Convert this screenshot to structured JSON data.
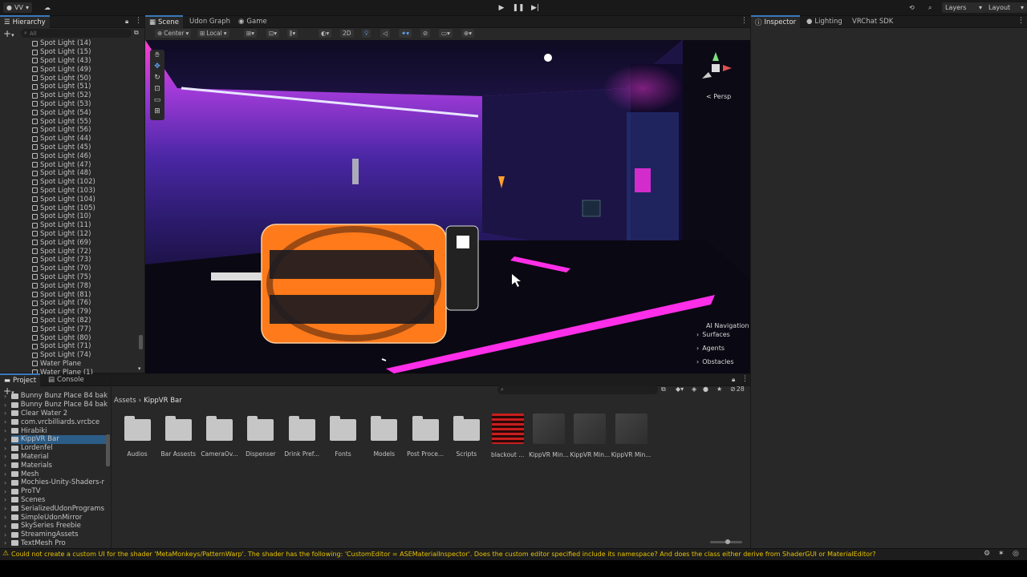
{
  "toolbar": {
    "account": "VV",
    "layers": "Layers",
    "layout": "Layout"
  },
  "hierarchy": {
    "title": "Hierarchy",
    "search_placeholder": "All",
    "items": [
      "Spot Light (14)",
      "Spot Light (15)",
      "Spot Light (43)",
      "Spot Light (49)",
      "Spot Light (50)",
      "Spot Light (51)",
      "Spot Light (52)",
      "Spot Light (53)",
      "Spot Light (54)",
      "Spot Light (55)",
      "Spot Light (56)",
      "Spot Light (44)",
      "Spot Light (45)",
      "Spot Light (46)",
      "Spot Light (47)",
      "Spot Light (48)",
      "Spot Light (102)",
      "Spot Light (103)",
      "Spot Light (104)",
      "Spot Light (105)",
      "Spot Light (10)",
      "Spot Light (11)",
      "Spot Light (12)",
      "Spot Light (69)",
      "Spot Light (72)",
      "Spot Light (73)",
      "Spot Light (70)",
      "Spot Light (75)",
      "Spot Light (78)",
      "Spot Light (81)",
      "Spot Light (76)",
      "Spot Light (79)",
      "Spot Light (82)",
      "Spot Light (77)",
      "Spot Light (80)",
      "Spot Light (71)",
      "Spot Light (74)",
      "Water Plane",
      "Water Plane (1)"
    ]
  },
  "scene_tabs": [
    "Scene",
    "Udon Graph",
    "Game"
  ],
  "scene_toolbar": {
    "pivot": "Center",
    "space": "Local",
    "mode_2d": "2D"
  },
  "gizmo": {
    "persp": "Persp"
  },
  "ai_navigation": {
    "title": "AI Navigation",
    "items": [
      "Surfaces",
      "Agents",
      "Obstacles"
    ]
  },
  "inspector_tabs": [
    "Inspector",
    "Lighting",
    "VRChat SDK"
  ],
  "project": {
    "tabs": [
      "Project",
      "Console"
    ],
    "breadcrumb_root": "Assets",
    "breadcrumb_current": "KippVR Bar",
    "item_count": "28",
    "tree": [
      "Bunny Bunz Place B4 bak",
      "Bunny Bunz Place B4 bak",
      "Clear Water 2",
      "com.vrcbilliards.vrcbce",
      "Hirabiki",
      "KippVR Bar",
      "Lordenfel",
      "Material",
      "Materials",
      "Mesh",
      "Mochies-Unity-Shaders-r",
      "ProTV",
      "Scenes",
      "SerializedUdonPrograms",
      "SimpleUdonMirror",
      "SkySeries Freebie",
      "StreamingAssets",
      "TextMesh Pro"
    ],
    "selected_tree_index": 5,
    "assets": [
      "Audios",
      "Bar Assests",
      "CameraOv...",
      "Dispenser",
      "Drink Pref...",
      "Fonts",
      "Models",
      "Post Proce...",
      "Scripts",
      "blackout ...",
      "KippVR Min...",
      "KippVR Min...",
      "KippVR Min..."
    ]
  },
  "status": {
    "message": "Could not create a custom UI for the shader 'MetaMonkeys/PatternWarp'. The shader has the following: 'CustomEditor = ASEMaterialInspector'. Does the custom editor specified include its namespace? And does the class either derive from ShaderGUI or MaterialEditor?"
  },
  "colors": {
    "accent": "#3a79bb",
    "selection": "#2c5d87",
    "neon_pink": "#ff2ee8",
    "neon_purple": "#7a2cff",
    "warning": "#f2c200"
  }
}
